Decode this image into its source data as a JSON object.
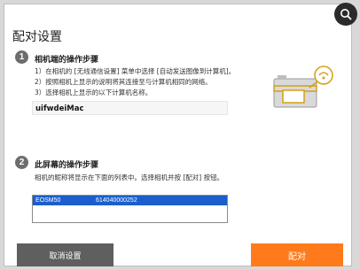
{
  "dialog": {
    "title": "配对设置"
  },
  "step1": {
    "number": "1",
    "title": "相机端的操作步骤",
    "instructions": [
      "1）在相机的 [无线通信设置] 菜单中选择 [自动发送图像到计算机]。",
      "2）按照相机上显示的说明将其连接至与计算机相同的网络。",
      "3）选择相机上显示的以下计算机名称。"
    ],
    "computer_name": "uifwdeiMac"
  },
  "step2": {
    "number": "2",
    "title": "此屏幕的操作步骤",
    "description": "相机的昵称将显示在下面的列表中。选择相机并按 [配对] 按钮。",
    "cameras": [
      {
        "name": "EOSM50",
        "id": "614040000252"
      }
    ]
  },
  "buttons": {
    "cancel": "取消设置",
    "pair": "配对"
  },
  "colors": {
    "accent_orange": "#ff7a1a",
    "selection_blue": "#1a5fcc",
    "camera_outline": "#d4a017"
  },
  "icons": {
    "search": "search-icon",
    "camera": "camera-wifi-illustration"
  }
}
